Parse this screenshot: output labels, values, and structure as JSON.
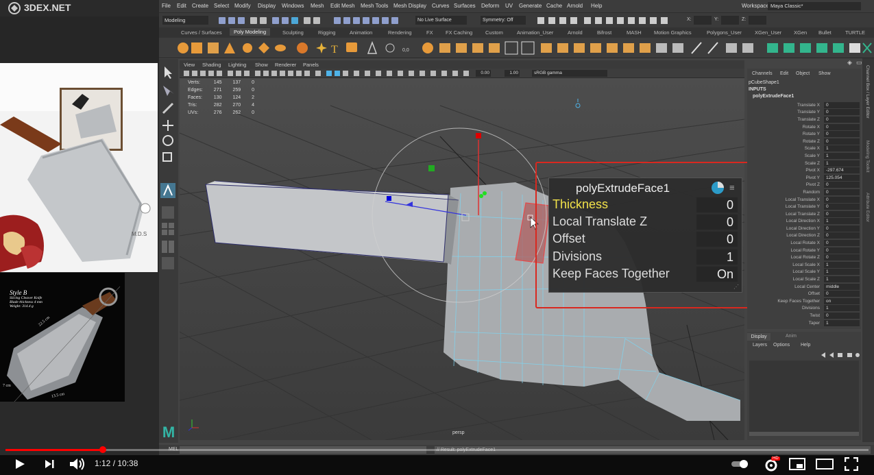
{
  "site_logo": "3DEX.NET",
  "reference": {
    "stamp": "M.D.S",
    "card_title": "Style B",
    "card_lines": [
      "Slicing Cleaver Knife",
      "Blade thickness 4 mm",
      "Weight: 314.4 g"
    ],
    "dim_length": "22.5 cm",
    "dim_width": "13.5 cm",
    "dim_height": "7 cm"
  },
  "menubar": [
    "File",
    "Edit",
    "Create",
    "Select",
    "Modify",
    "Display",
    "Windows",
    "Mesh",
    "Edit Mesh",
    "Mesh Tools",
    "Mesh Display",
    "Curves",
    "Surfaces",
    "Deform",
    "UV",
    "Generate",
    "Cache",
    "Arnold",
    "Help"
  ],
  "workspace": {
    "label": "Workspace :",
    "value": "Maya Classic*"
  },
  "status": {
    "mode": "Modeling",
    "live_surface": "No Live Surface",
    "symmetry": "Symmetry: Off",
    "x": "X:",
    "y": "Y:",
    "z": "Z:"
  },
  "shelf_tabs": [
    "Curves / Surfaces",
    "Poly Modeling",
    "Sculpting",
    "Rigging",
    "Animation",
    "Rendering",
    "FX",
    "FX Caching",
    "Custom",
    "Animation_User",
    "Arnold",
    "Bifrost",
    "MASH",
    "Motion Graphics",
    "Polygons_User",
    "XGen_User",
    "XGen",
    "Bullet",
    "TURTLE"
  ],
  "panel_menu": [
    "View",
    "Shading",
    "Lighting",
    "Show",
    "Renderer",
    "Panels"
  ],
  "panel_toolbar": {
    "near": "0.00",
    "far": "1.00",
    "color_space": "sRGB gamma"
  },
  "hud": [
    {
      "label": "Verts:",
      "a": "145",
      "b": "137",
      "c": "0"
    },
    {
      "label": "Edges:",
      "a": "271",
      "b": "259",
      "c": "0"
    },
    {
      "label": "Faces:",
      "a": "130",
      "b": "124",
      "c": "2"
    },
    {
      "label": "Tris:",
      "a": "282",
      "b": "270",
      "c": "4"
    },
    {
      "label": "UVs:",
      "a": "276",
      "b": "262",
      "c": "0"
    }
  ],
  "camera_label": "persp",
  "channel_box": {
    "menu": [
      "Channels",
      "Edit",
      "Object",
      "Show"
    ],
    "shape": "pCubeShape1",
    "inputs": "INPUTS",
    "node": "polyExtrudeFace1",
    "attrs": [
      {
        "l": "Translate X",
        "v": "0"
      },
      {
        "l": "Translate Y",
        "v": "0"
      },
      {
        "l": "Translate Z",
        "v": "0"
      },
      {
        "l": "Rotate X",
        "v": "0"
      },
      {
        "l": "Rotate Y",
        "v": "0"
      },
      {
        "l": "Rotate Z",
        "v": "0"
      },
      {
        "l": "Scale X",
        "v": "1"
      },
      {
        "l": "Scale Y",
        "v": "1"
      },
      {
        "l": "Scale Z",
        "v": "1"
      },
      {
        "l": "Pivot X",
        "v": "-297.674"
      },
      {
        "l": "Pivot Y",
        "v": "125.054"
      },
      {
        "l": "Pivot Z",
        "v": "0"
      },
      {
        "l": "Random",
        "v": "0"
      },
      {
        "l": "Local Translate X",
        "v": "0"
      },
      {
        "l": "Local Translate Y",
        "v": "0"
      },
      {
        "l": "Local Translate Z",
        "v": "0"
      },
      {
        "l": "Local Direction X",
        "v": "1"
      },
      {
        "l": "Local Direction Y",
        "v": "0"
      },
      {
        "l": "Local Direction Z",
        "v": "0"
      },
      {
        "l": "Local Rotate X",
        "v": "0"
      },
      {
        "l": "Local Rotate Y",
        "v": "0"
      },
      {
        "l": "Local Rotate Z",
        "v": "0"
      },
      {
        "l": "Local Scale X",
        "v": "1"
      },
      {
        "l": "Local Scale Y",
        "v": "1"
      },
      {
        "l": "Local Scale Z",
        "v": "1"
      },
      {
        "l": "Local Center",
        "v": "middle"
      },
      {
        "l": "Offset",
        "v": "0"
      },
      {
        "l": "Keep Faces Together",
        "v": "on"
      },
      {
        "l": "Divisions",
        "v": "1"
      },
      {
        "l": "Twist",
        "v": "0"
      },
      {
        "l": "Taper",
        "v": "1"
      }
    ]
  },
  "side_tabs": [
    "Channel Box / Layer Editor",
    "Modeling Toolkit",
    "Attribute Editor"
  ],
  "layer_editor": {
    "tabs": [
      "Display",
      "Anim"
    ],
    "menu": [
      "Layers",
      "Options",
      "Help"
    ]
  },
  "overlay": {
    "title": "polyExtrudeFace1",
    "rows": [
      {
        "label": "Thickness",
        "value": "0"
      },
      {
        "label": "Local Translate Z",
        "value": "0"
      },
      {
        "label": "Offset",
        "value": "0"
      },
      {
        "label": "Divisions",
        "value": "1"
      },
      {
        "label": "Keep Faces Together",
        "value": "On"
      }
    ]
  },
  "cmdline": {
    "lang": "MEL",
    "result": "// Result: polyExtrudeFace1"
  },
  "video": {
    "time": "1:12 / 10:38",
    "progress": 0.113,
    "hd_badge": "HD"
  },
  "colors": {
    "accent_red": "#d9281f",
    "highlight_yellow": "#f2e24a",
    "progress_red": "#ff0000"
  }
}
